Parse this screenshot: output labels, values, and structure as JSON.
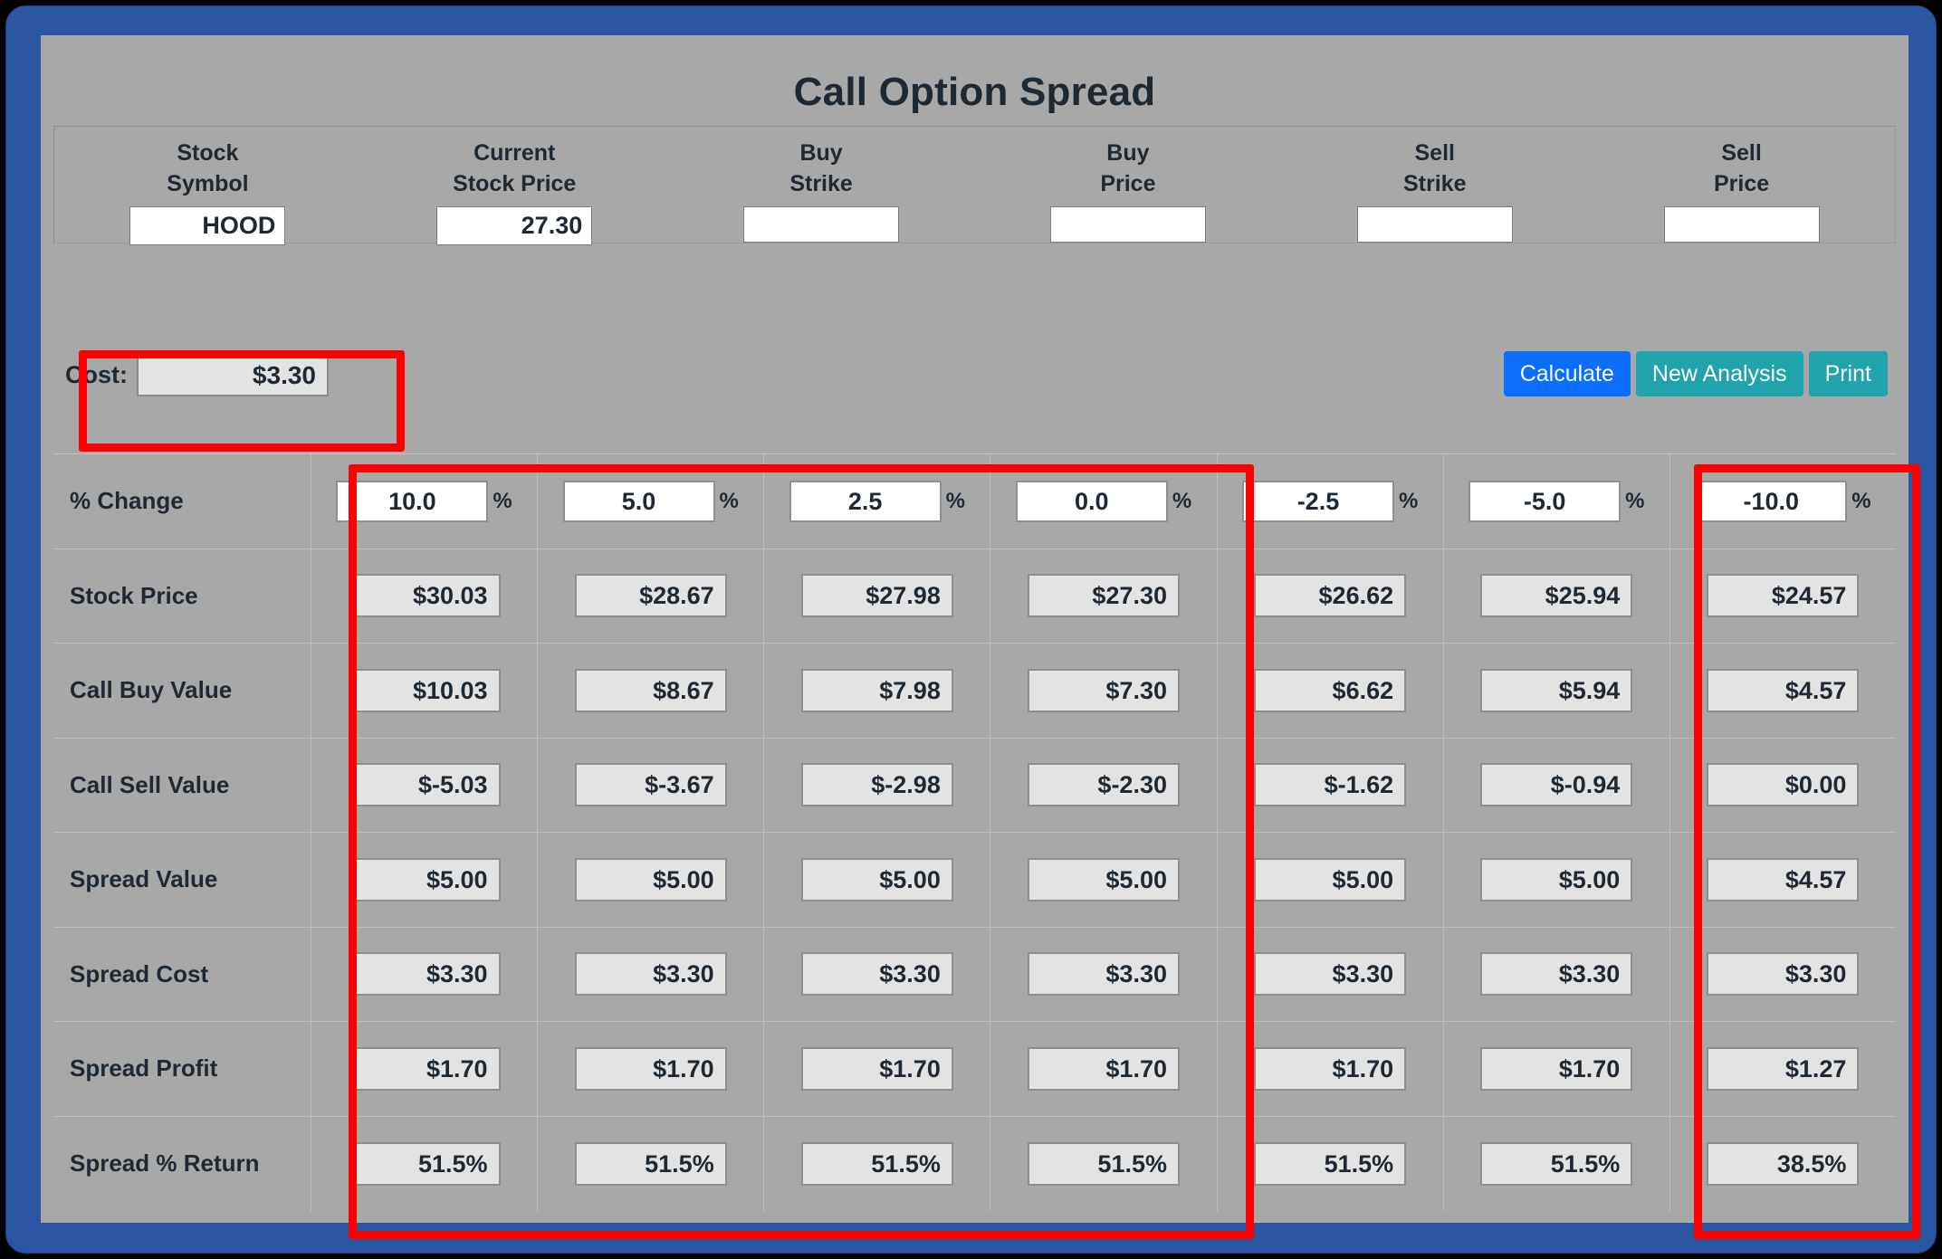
{
  "window": {
    "title": "Call Option Spread"
  },
  "inputs": {
    "fields": [
      {
        "label_line1": "Stock",
        "label_line2": "Symbol",
        "value": "HOOD",
        "name": "stock-symbol"
      },
      {
        "label_line1": "Current",
        "label_line2": "Stock Price",
        "value": "27.30",
        "name": "current-stock-price"
      },
      {
        "label_line1": "Buy",
        "label_line2": "Strike",
        "value": "",
        "name": "buy-strike"
      },
      {
        "label_line1": "Buy",
        "label_line2": "Price",
        "value": "",
        "name": "buy-price"
      },
      {
        "label_line1": "Sell",
        "label_line2": "Strike",
        "value": "",
        "name": "sell-strike"
      },
      {
        "label_line1": "Sell",
        "label_line2": "Price",
        "value": "",
        "name": "sell-price"
      }
    ]
  },
  "cost": {
    "label": "Cost:",
    "value": "$3.30"
  },
  "buttons": {
    "calculate": "Calculate",
    "new_analysis": "New Analysis",
    "print": "Print"
  },
  "results": {
    "percent_sign": "%",
    "row_labels": [
      "% Change",
      "Stock Price",
      "Call Buy Value",
      "Call Sell Value",
      "Spread Value",
      "Spread Cost",
      "Spread Profit",
      "Spread % Return"
    ],
    "percent_change": [
      "10.0",
      "5.0",
      "2.5",
      "0.0",
      "-2.5",
      "-5.0",
      "-10.0"
    ],
    "stock_price": [
      "$30.03",
      "$28.67",
      "$27.98",
      "$27.30",
      "$26.62",
      "$25.94",
      "$24.57"
    ],
    "call_buy_value": [
      "$10.03",
      "$8.67",
      "$7.98",
      "$7.30",
      "$6.62",
      "$5.94",
      "$4.57"
    ],
    "call_sell_value": [
      "$-5.03",
      "$-3.67",
      "$-2.98",
      "$-2.30",
      "$-1.62",
      "$-0.94",
      "$0.00"
    ],
    "spread_value": [
      "$5.00",
      "$5.00",
      "$5.00",
      "$5.00",
      "$5.00",
      "$5.00",
      "$4.57"
    ],
    "spread_cost": [
      "$3.30",
      "$3.30",
      "$3.30",
      "$3.30",
      "$3.30",
      "$3.30",
      "$3.30"
    ],
    "spread_profit": [
      "$1.70",
      "$1.70",
      "$1.70",
      "$1.70",
      "$1.70",
      "$1.70",
      "$1.27"
    ],
    "spread_return": [
      "51.5%",
      "51.5%",
      "51.5%",
      "51.5%",
      "51.5%",
      "51.5%",
      "38.5%"
    ]
  },
  "annotations": {
    "highlight_color": "#ff0000",
    "boxes": [
      "cost-field",
      "columns-1-to-4",
      "column-7"
    ]
  },
  "colors": {
    "window_border": "#2a56a4",
    "panel_background": "#a8a8a8",
    "field_background": "#ffffff",
    "readonly_field_background": "#e3e3e3",
    "calculate_button": "#0b6efd",
    "teal_button": "#20a3ad",
    "text": "#1f2933"
  }
}
